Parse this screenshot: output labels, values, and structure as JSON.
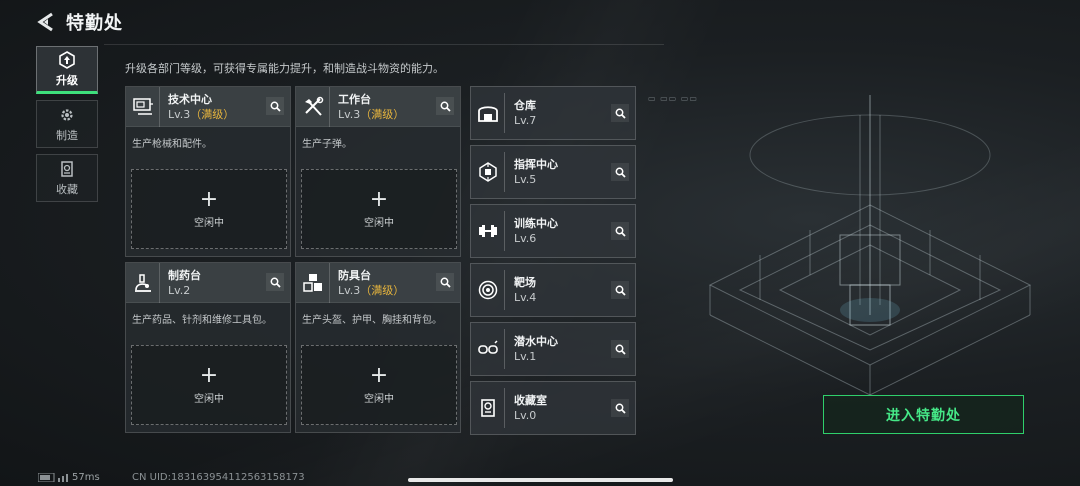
{
  "header": {
    "title": "特勤处"
  },
  "sidenav": [
    {
      "label": "升级",
      "icon": "upgrade-icon",
      "active": true
    },
    {
      "label": "制造",
      "icon": "gear-icon",
      "active": false
    },
    {
      "label": "收藏",
      "icon": "collection-icon",
      "active": false
    }
  ],
  "subtitle": "升级各部门等级，可获得专属能力提升，和制造战斗物资的能力。",
  "cards": [
    {
      "name": "技术中心",
      "level": "Lv.3",
      "max_tag": "（满级）",
      "desc": "生产枪械和配件。",
      "slot_plus": "+",
      "slot_status": "空闲中",
      "icon": "computer-icon"
    },
    {
      "name": "工作台",
      "level": "Lv.3",
      "max_tag": "（满级）",
      "desc": "生产子弹。",
      "slot_plus": "+",
      "slot_status": "空闲中",
      "icon": "tools-icon"
    },
    {
      "name": "制药台",
      "level": "Lv.2",
      "max_tag": "",
      "desc": "生产药品、针剂和维修工具包。",
      "slot_plus": "+",
      "slot_status": "空闲中",
      "icon": "microscope-icon"
    },
    {
      "name": "防具台",
      "level": "Lv.3",
      "max_tag": "（满级）",
      "desc": "生产头盔、护甲、胸挂和背包。",
      "slot_plus": "+",
      "slot_status": "空闲中",
      "icon": "armor-boxes-icon"
    }
  ],
  "minis": [
    {
      "name": "仓库",
      "level": "Lv.7",
      "icon": "warehouse-icon"
    },
    {
      "name": "指挥中心",
      "level": "Lv.5",
      "icon": "chip-icon"
    },
    {
      "name": "训练中心",
      "level": "Lv.6",
      "icon": "dumbbell-icon"
    },
    {
      "name": "靶场",
      "level": "Lv.4",
      "icon": "target-icon"
    },
    {
      "name": "潜水中心",
      "level": "Lv.1",
      "icon": "diving-mask-icon"
    },
    {
      "name": "收藏室",
      "level": "Lv.0",
      "icon": "collection-room-icon"
    }
  ],
  "enter_button": "进入特勤处",
  "footer": {
    "ping": "57ms",
    "uid": "CN UID:183163954112563158173"
  },
  "colors": {
    "accent_green": "#45e887",
    "max_level": "#e7b53d"
  }
}
